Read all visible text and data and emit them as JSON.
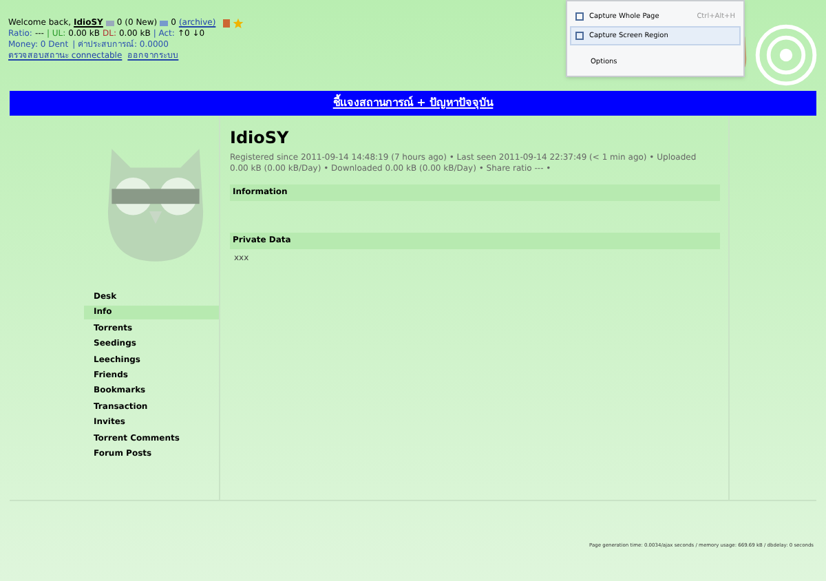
{
  "header": {
    "welcome": "Welcome back,",
    "username": "IdioSY",
    "messages": "0 (0 New)",
    "inbox": "0",
    "archive": "(archive)",
    "ratio_label": "Ratio:",
    "ratio": "---",
    "ul_label": "| UL:",
    "ul": "0.00 kB",
    "dl_label": "DL:",
    "dl": "0.00 kB",
    "act_label": "| Act:",
    "act": "↑0 ↓0",
    "money": "Money: 0 Dent",
    "exp": "| ค่าประสบการณ์: 0.0000",
    "links": [
      "ตรวจสอบสถานะ connectable",
      "ออกจากระบบ"
    ]
  },
  "capture_menu": {
    "items": [
      {
        "label": "Capture Whole Page",
        "shortcut": "Ctrl+Alt+H",
        "selected": false
      },
      {
        "label": "Capture Screen Region",
        "selected": true
      },
      {
        "label": "Options",
        "kind": "plain",
        "selected": false
      }
    ]
  },
  "banner": "ชี้แจงสถานการณ์ + ปัญหาปัจจุบัน",
  "sidebar": {
    "items": [
      {
        "label": "Desk",
        "selected": false
      },
      {
        "label": "Info",
        "selected": true
      },
      {
        "label": "Torrents",
        "selected": false
      },
      {
        "label": "Seedings",
        "selected": false
      },
      {
        "label": "Leechings",
        "selected": false
      },
      {
        "label": "Friends",
        "selected": false
      },
      {
        "label": "Bookmarks",
        "selected": false
      },
      {
        "label": "Transaction",
        "selected": false
      },
      {
        "label": "Invites",
        "selected": false
      },
      {
        "label": "Torrent Comments",
        "selected": false
      },
      {
        "label": "Forum Posts",
        "selected": false
      }
    ]
  },
  "profile": {
    "name": "IdioSY",
    "summary": "Registered since 2011-09-14 14:48:19 (7 hours ago) • Last seen 2011-09-14 22:37:49 (< 1 min ago) • Uploaded 0.00 kB (0.00 kB/Day) • Downloaded 0.00 kB (0.00 kB/Day) • Share ratio --- •",
    "sections": [
      {
        "title": "Information"
      },
      {
        "title": "Private Data",
        "body": "xxx"
      }
    ]
  },
  "footer": "Page generation time: 0.0034/ajax seconds / memory usage: 669.69 kB / dbdelay: 0 seconds"
}
